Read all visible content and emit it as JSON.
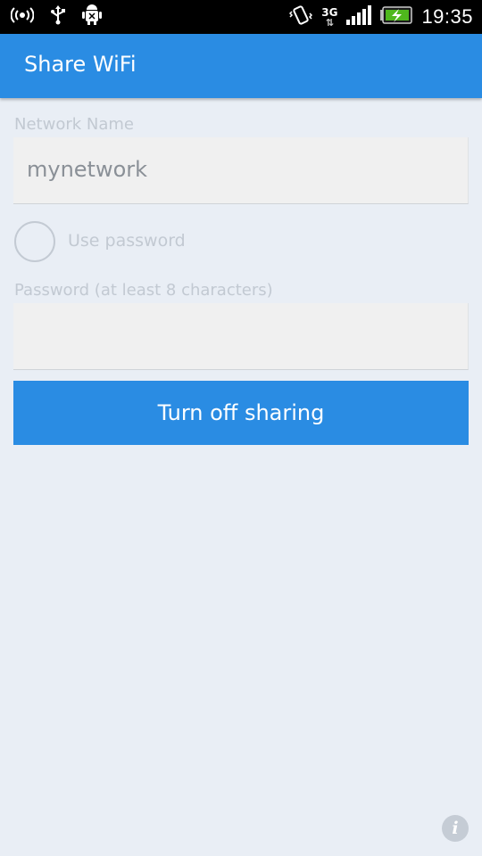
{
  "status_bar": {
    "time": "19:35",
    "network_type": "3G",
    "network_arrows": "⇅",
    "icons": [
      "hotspot-icon",
      "usb-icon",
      "android-debug-icon",
      "vibrate-icon",
      "signal-icon",
      "battery-charging-icon"
    ]
  },
  "action_bar": {
    "title": "Share WiFi",
    "background": "#2a8ce3"
  },
  "form": {
    "network_name_label": "Network Name",
    "network_name_value": "mynetwork",
    "use_password_label": "Use password",
    "use_password_checked": false,
    "password_label": "Password (at least 8 characters)",
    "password_value": "",
    "sharing_button_label": "Turn off sharing"
  },
  "footer": {
    "info_glyph": "i"
  },
  "colors": {
    "accent": "#2a8ce3",
    "background": "#e9eef5",
    "muted_text": "#c2c9d2",
    "field_bg": "#f0f0f0"
  }
}
